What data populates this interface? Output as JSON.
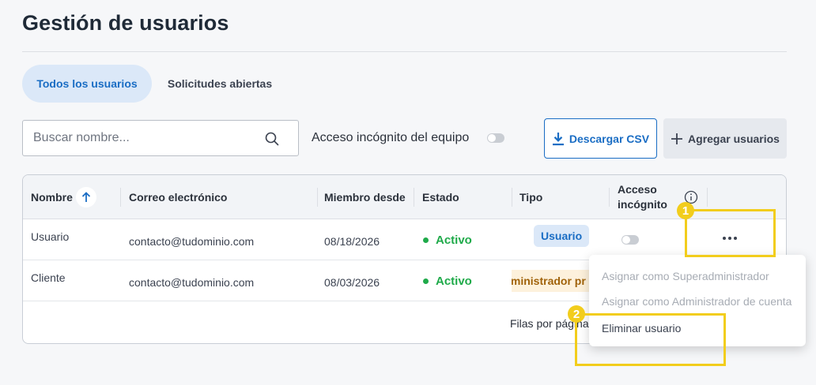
{
  "page": {
    "title": "Gestión de usuarios"
  },
  "tabs": [
    {
      "label": "Todos los usuarios",
      "active": true
    },
    {
      "label": "Solicitudes abiertas",
      "active": false
    }
  ],
  "toolbar": {
    "search_placeholder": "Buscar nombre...",
    "search_icon": "search-icon",
    "team_incognito_label": "Acceso incógnito del equipo",
    "team_incognito_enabled": false,
    "download_csv_label": "Descargar CSV",
    "add_users_label": "Agregar usuarios"
  },
  "table": {
    "columns": {
      "name": "Nombre",
      "email": "Correo electrónico",
      "member_since": "Miembro desde",
      "status": "Estado",
      "type": "Tipo",
      "incognito_line1": "Acceso",
      "incognito_line2": "incógnito"
    },
    "rows": [
      {
        "name": "Usuario",
        "email": "contacto@tudominio.com",
        "member_since": "08/18/2026",
        "status": "Activo",
        "type": "Usuario",
        "incognito": false
      },
      {
        "name": "Cliente",
        "email": "contacto@tudominio.com",
        "member_since": "08/03/2026",
        "status": "Activo",
        "type": "Administrador pr",
        "type_visible": "lministrador pr"
      }
    ],
    "rows_per_page_label": "Filas por página"
  },
  "context_menu": {
    "items": [
      {
        "label": "Asignar como Superadministrador",
        "enabled": false
      },
      {
        "label": "Asignar como Administrador de cuenta",
        "enabled": false
      },
      {
        "label": "Eliminar usuario",
        "enabled": true
      }
    ]
  },
  "annotations": {
    "step1": "1",
    "step2": "2"
  },
  "colors": {
    "accent": "#1a6dc4",
    "active": "#1faa4a",
    "highlight": "#f2cd1c",
    "admin_badge_text": "#a0620a"
  }
}
